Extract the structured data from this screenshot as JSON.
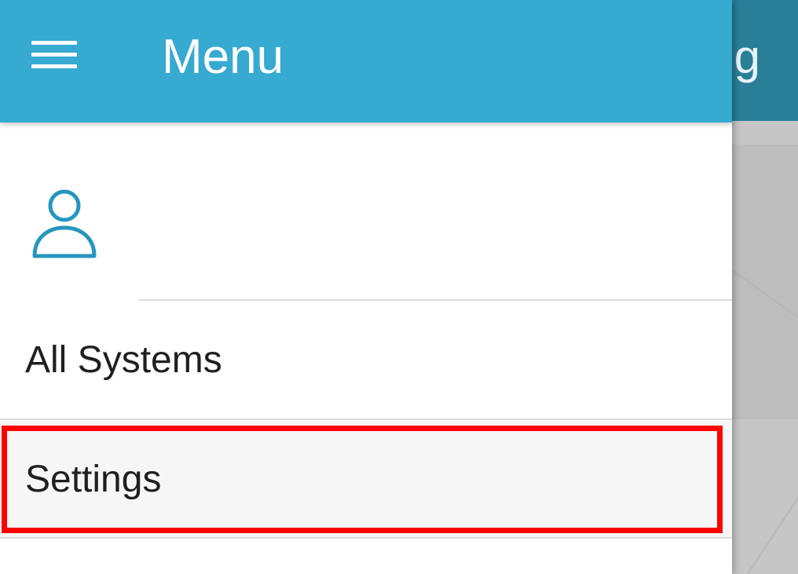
{
  "background": {
    "header_title_fragment": "ring"
  },
  "drawer": {
    "menu_icon": "hamburger-menu-icon",
    "title": "Menu",
    "user_icon": "user-avatar-icon",
    "items": [
      {
        "label": "All Systems"
      },
      {
        "label": "Settings",
        "highlighted": true
      }
    ]
  },
  "colors": {
    "drawer_header": "#36aad1",
    "background_header": "#2a7f98",
    "accent_icon": "#2596bf",
    "highlight_border": "#ff0000"
  }
}
